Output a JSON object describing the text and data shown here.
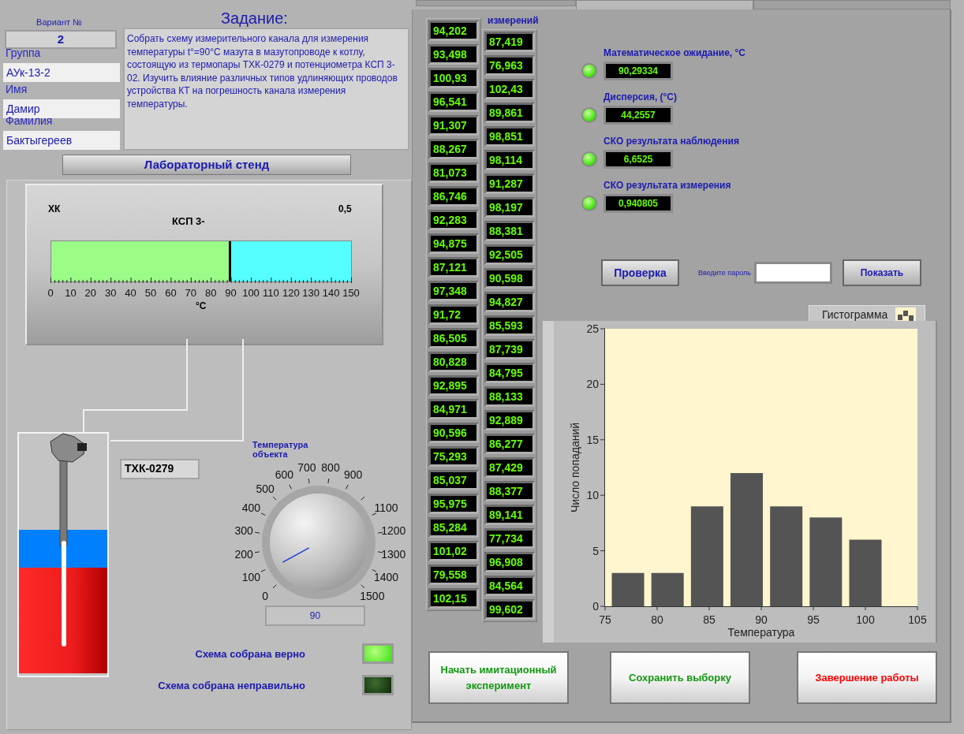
{
  "tabs": [
    {
      "selected": false
    },
    {
      "selected": true
    },
    {
      "selected": false
    }
  ],
  "student": {
    "variant_label": "Вариант №",
    "variant": "2",
    "fields": [
      {
        "label": "Группа",
        "value": "АУк-13-2"
      },
      {
        "label": "Имя",
        "value": "Дамир"
      },
      {
        "label": "Фамилия",
        "value": "Бактыгереев"
      }
    ]
  },
  "task": {
    "title": "Задание:",
    "text": "Собрать схему измерительного канала для измерения температуры t°=90°С мазута в мазутопроводе к котлу, состоящую из термопары ТХК-0279 и потенциометра КСП 3-02. Изучить влияние различных типов удлиняющих проводов устройства КТ на погрешность канала измерения температуры."
  },
  "stand_button": "Лабораторный стенд",
  "gauge": {
    "type_label": "ХК",
    "class_label": "0,5",
    "title": "КСП 3-",
    "level": 0.6,
    "scale": [
      "0",
      "10",
      "20",
      "30",
      "40",
      "50",
      "60",
      "70",
      "80",
      "90",
      "100",
      "110",
      "120",
      "130",
      "140",
      "150"
    ],
    "unit": "°C"
  },
  "sensor_label": "ТХК-0279",
  "knob": {
    "label": "Температура объекта",
    "scale": [
      "0",
      "100",
      "200",
      "300",
      "400",
      "500",
      "600",
      "700",
      "800",
      "900",
      "1100",
      "1200",
      "1300",
      "1400",
      "1500"
    ],
    "value": "90"
  },
  "indicators": [
    {
      "label": "Схема собрана верно",
      "on": true
    },
    {
      "label": "Схема собрана неправильно",
      "on": false
    }
  ],
  "measurements": {
    "label": "измерений",
    "columns": [
      [
        "94,202",
        "93,498",
        "100,93",
        "96,541",
        "91,307",
        "88,267",
        "81,073",
        "86,746",
        "92,283",
        "94,875",
        "87,121",
        "97,348",
        "91,72",
        "86,505",
        "80,828",
        "92,895",
        "84,971",
        "90,596",
        "75,293",
        "85,037",
        "95,975",
        "85,284",
        "101,02",
        "79,558",
        "102,15"
      ],
      [
        "87,419",
        "76,963",
        "102,43",
        "89,861",
        "98,851",
        "98,114",
        "91,287",
        "98,197",
        "88,381",
        "92,505",
        "90,598",
        "94,827",
        "85,593",
        "87,739",
        "84,795",
        "88,133",
        "92,889",
        "86,277",
        "87,429",
        "88,377",
        "89,141",
        "77,734",
        "96,908",
        "84,564",
        "99,602"
      ]
    ]
  },
  "statistics": [
    {
      "label": "Математическое ожидание, °С",
      "value": "90,29334",
      "on": true
    },
    {
      "label": "Дисперсия, (°С)",
      "value": "44,2557",
      "on": true
    },
    {
      "label": "СКО результата наблюдения",
      "value": "6,6525",
      "on": true
    },
    {
      "label": "СКО результата измерения",
      "value": "0,940805",
      "on": true
    }
  ],
  "check_button": "Проверка",
  "password": {
    "label": "Введите пароль"
  },
  "show_button": "Показать",
  "histogram": {
    "chart_data": {
      "type": "bar",
      "xlabel": "Температура",
      "ylabel": "Число попаданий",
      "x": [
        77.2,
        81.0,
        84.8,
        88.6,
        92.4,
        96.2,
        100.0
      ],
      "series": [
        {
          "name": "Гистограмма",
          "color": "#545454",
          "values": [
            3,
            3,
            9,
            12,
            9,
            8,
            6
          ]
        }
      ],
      "xlim": [
        75,
        105
      ],
      "ylim": [
        0,
        25
      ],
      "xticks": [
        75,
        80,
        85,
        90,
        95,
        100,
        105
      ],
      "yticks": [
        0,
        5,
        10,
        15,
        20,
        25
      ]
    }
  },
  "actions": [
    {
      "label": "Начать имитационный эксперимент",
      "color": "#119911"
    },
    {
      "label": "Сохранить выборку",
      "color": "#119911"
    },
    {
      "label": "Завершение работы",
      "color": "#ff0000"
    }
  ]
}
